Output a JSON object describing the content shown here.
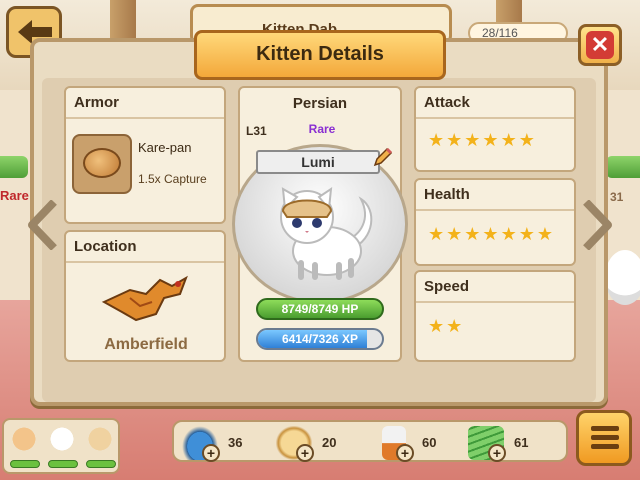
{
  "background": {
    "top_title": "Kitten Dab...",
    "counter": "28/116",
    "left_rarity": "Rare",
    "right_number": "31"
  },
  "dialog": {
    "title": "Kitten Details",
    "close_icon": "close-x-icon"
  },
  "armor": {
    "header": "Armor",
    "name": "Kare-pan",
    "bonus": "1.5x Capture",
    "icon": "bread-icon"
  },
  "location": {
    "header": "Location",
    "name": "Amberfield",
    "icon": "dragon-island-icon"
  },
  "kitten": {
    "breed": "Persian",
    "level": "L31",
    "rarity": "Rare",
    "name": "Lumi",
    "hp": "8749/8749 HP",
    "hp_fraction": 1.0,
    "xp": "6414/7326 XP",
    "xp_fraction": 0.876
  },
  "stats": {
    "attack_label": "Attack",
    "attack_stars": 6,
    "health_label": "Health",
    "health_stars": 7,
    "speed_label": "Speed",
    "speed_stars": 2
  },
  "resources": [
    {
      "icon": "cat-food-bowl-icon",
      "count": "36"
    },
    {
      "icon": "bread-slice-icon",
      "count": "20"
    },
    {
      "icon": "milk-carton-icon",
      "count": "60"
    },
    {
      "icon": "cash-stack-icon",
      "count": "61"
    }
  ],
  "colors": {
    "accent": "#f3a83a",
    "rare": "#8a2fd2",
    "hp": "#4a9d2f",
    "xp": "#2f80d6",
    "close": "#d33b35",
    "star": "#f3b21a"
  }
}
